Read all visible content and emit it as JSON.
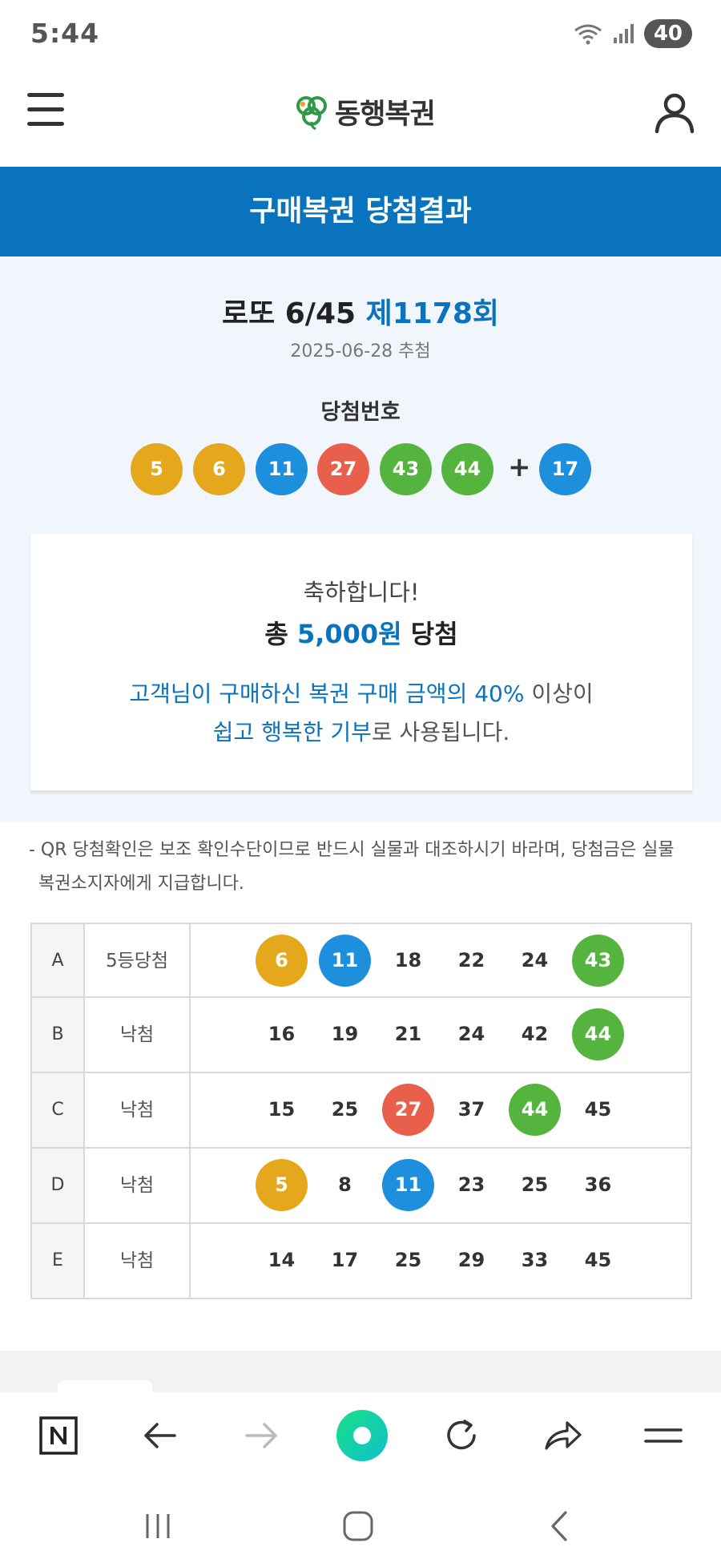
{
  "status_bar": {
    "time": "5:44",
    "battery": "40"
  },
  "header": {
    "logo_text": "동행복권"
  },
  "banner": {
    "title": "구매복권 당첨결과"
  },
  "draw": {
    "game": "로또 6/45",
    "round": "제1178회",
    "date": "2025-06-28 추첨",
    "win_label": "당첨번호",
    "numbers": [
      "5",
      "6",
      "11",
      "27",
      "43",
      "44"
    ],
    "plus": "+",
    "bonus": "17"
  },
  "card": {
    "congrats": "축하합니다!",
    "prize_prefix": "총",
    "prize_amount": "5,000원",
    "prize_suffix": "당첨",
    "donate_line1_hl": "고객님이 구매하신 복권 구매 금액의 40%",
    "donate_line1_rest": " 이상이",
    "donate_line2_hl": "쉽고 행복한 기부",
    "donate_line2_rest": "로 사용됩니다."
  },
  "notice": {
    "line1": "- QR 당첨확인은 보조 확인수단이므로 반드시 실물과 대조하시기 바라며, 당첨금은 실물",
    "line2": "복권소지자에게 지급합니다."
  },
  "tickets": [
    {
      "letter": "A",
      "result": "5등당첨",
      "numbers": [
        "6",
        "11",
        "18",
        "22",
        "24",
        "43"
      ]
    },
    {
      "letter": "B",
      "result": "낙첨",
      "numbers": [
        "16",
        "19",
        "21",
        "24",
        "42",
        "44"
      ]
    },
    {
      "letter": "C",
      "result": "낙첨",
      "numbers": [
        "15",
        "25",
        "27",
        "37",
        "44",
        "45"
      ]
    },
    {
      "letter": "D",
      "result": "낙첨",
      "numbers": [
        "5",
        "8",
        "11",
        "23",
        "25",
        "36"
      ]
    },
    {
      "letter": "E",
      "result": "낙첨",
      "numbers": [
        "14",
        "17",
        "25",
        "29",
        "33",
        "45"
      ]
    }
  ],
  "colors": {
    "brand_blue": "#0a73bd",
    "ball_yellow": "#e5a71b",
    "ball_blue": "#1e8fdc",
    "ball_red": "#e8604c",
    "ball_green": "#55b43d"
  },
  "icons": {
    "browser_bar": [
      "naver-n-icon",
      "back-arrow-icon",
      "forward-arrow-icon",
      "home-circle-icon",
      "refresh-icon",
      "share-icon",
      "menu-icon"
    ],
    "nav_bar": [
      "recent-apps-icon",
      "home-icon",
      "back-icon"
    ]
  }
}
